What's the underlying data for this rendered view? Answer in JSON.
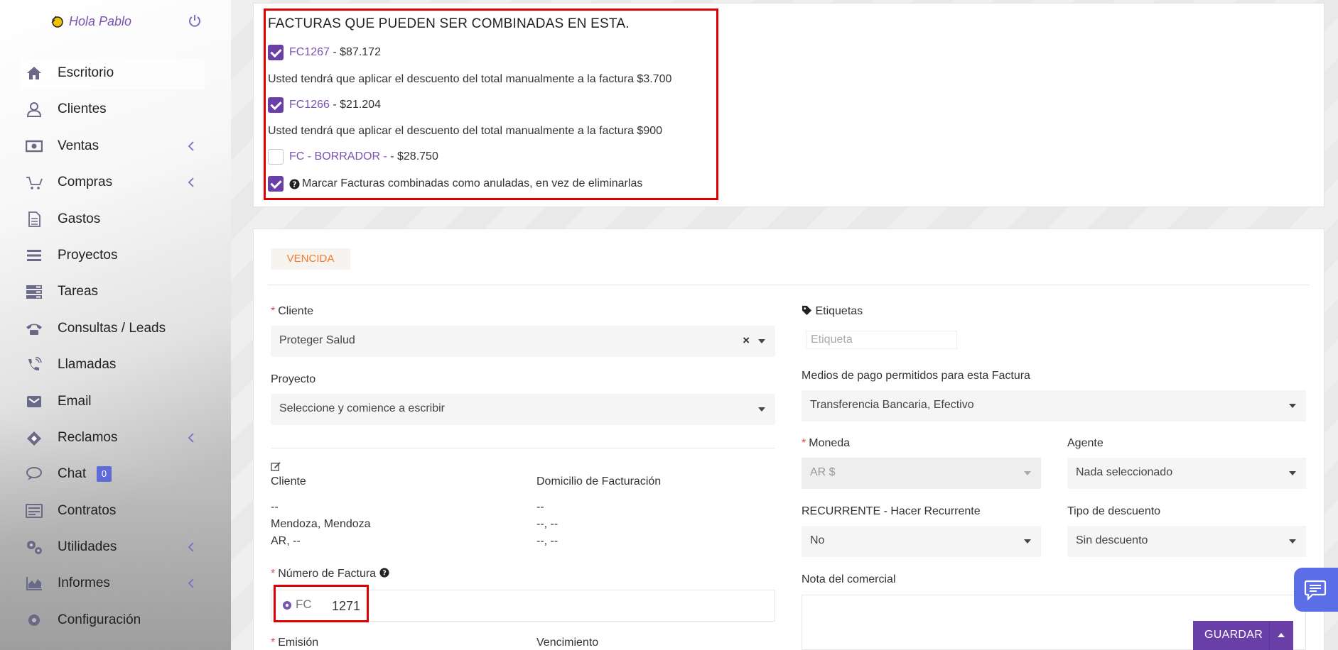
{
  "user": {
    "greeting": "Hola Pablo"
  },
  "menu": [
    {
      "label": "Escritorio",
      "icon": "home-icon",
      "active": true,
      "chevron": false
    },
    {
      "label": "Clientes",
      "icon": "user-icon",
      "chevron": false
    },
    {
      "label": "Ventas",
      "icon": "money-icon",
      "chevron": true
    },
    {
      "label": "Compras",
      "icon": "cart-icon",
      "chevron": true
    },
    {
      "label": "Gastos",
      "icon": "file-icon",
      "chevron": false
    },
    {
      "label": "Proyectos",
      "icon": "bars-icon",
      "chevron": false
    },
    {
      "label": "Tareas",
      "icon": "tasks-icon",
      "chevron": false
    },
    {
      "label": "Consultas / Leads",
      "icon": "phone-icon",
      "chevron": false
    },
    {
      "label": "Llamadas",
      "icon": "volume-phone-icon",
      "chevron": false
    },
    {
      "label": "Email",
      "icon": "envelope-icon",
      "chevron": false
    },
    {
      "label": "Reclamos",
      "icon": "ticket-icon",
      "chevron": true
    },
    {
      "label": "Chat",
      "icon": "chat-icon",
      "chevron": false,
      "badge": "0"
    },
    {
      "label": "Contratos",
      "icon": "contract-icon",
      "chevron": false
    },
    {
      "label": "Utilidades",
      "icon": "cogs-icon",
      "chevron": true
    },
    {
      "label": "Informes",
      "icon": "area-chart-icon",
      "chevron": true
    },
    {
      "label": "Configuración",
      "icon": "gear-icon",
      "chevron": false
    }
  ],
  "combine": {
    "title": "FACTURAS QUE PUEDEN SER COMBINADAS EN ESTA.",
    "invoices": [
      {
        "code": "FC1267",
        "amount": " - $87.172",
        "checked": true
      },
      {
        "code": "FC1266",
        "amount": " - $21.204",
        "checked": true
      },
      {
        "code": "FC - BORRADOR -",
        "amount": " - $28.750",
        "checked": false
      }
    ],
    "notes": [
      "Usted tendrá que aplicar el descuento del total manualmente a la factura $3.700",
      "Usted tendrá que aplicar el descuento del total manualmente a la factura $900"
    ],
    "mark_cancelled": "Marcar Facturas combinadas como anuladas, en vez de eliminarlas"
  },
  "form": {
    "status": "VENCIDA",
    "cliente_label": "Cliente",
    "cliente_value": "Proteger Salud",
    "proyecto_label": "Proyecto",
    "proyecto_placeholder": "Seleccione y comience a escribir",
    "address": {
      "cliente_label": "Cliente",
      "domicilio_label": "Domicilio de Facturación",
      "cliente_lines": [
        "--",
        "Mendoza, Mendoza",
        "AR, --"
      ],
      "domicilio_lines": [
        "--",
        "--, --",
        "--, --"
      ]
    },
    "numero_label": "Número de Factura",
    "numero_prefix": "FC",
    "numero_value": "1271",
    "emision_label": "Emisión",
    "vencimiento_label": "Vencimiento",
    "etiquetas_label": "Etiquetas",
    "etiqueta_placeholder": "Etiqueta",
    "medios_label": "Medios de pago permitidos para esta Factura",
    "medios_value": "Transferencia Bancaria, Efectivo",
    "moneda_label": "Moneda",
    "moneda_value": "AR $",
    "agente_label": "Agente",
    "agente_value": "Nada seleccionado",
    "recurrente_label": "RECURRENTE - Hacer Recurrente",
    "recurrente_value": "No",
    "descuento_label": "Tipo de descuento",
    "descuento_value": "Sin descuento",
    "nota_label": "Nota del comercial",
    "save_label": "GUARDAR"
  },
  "colors": {
    "brand": "#6b3fa8",
    "accent_blue": "#5b6ee8",
    "status_orange": "#f07c2c",
    "highlight_red": "#e00000"
  }
}
